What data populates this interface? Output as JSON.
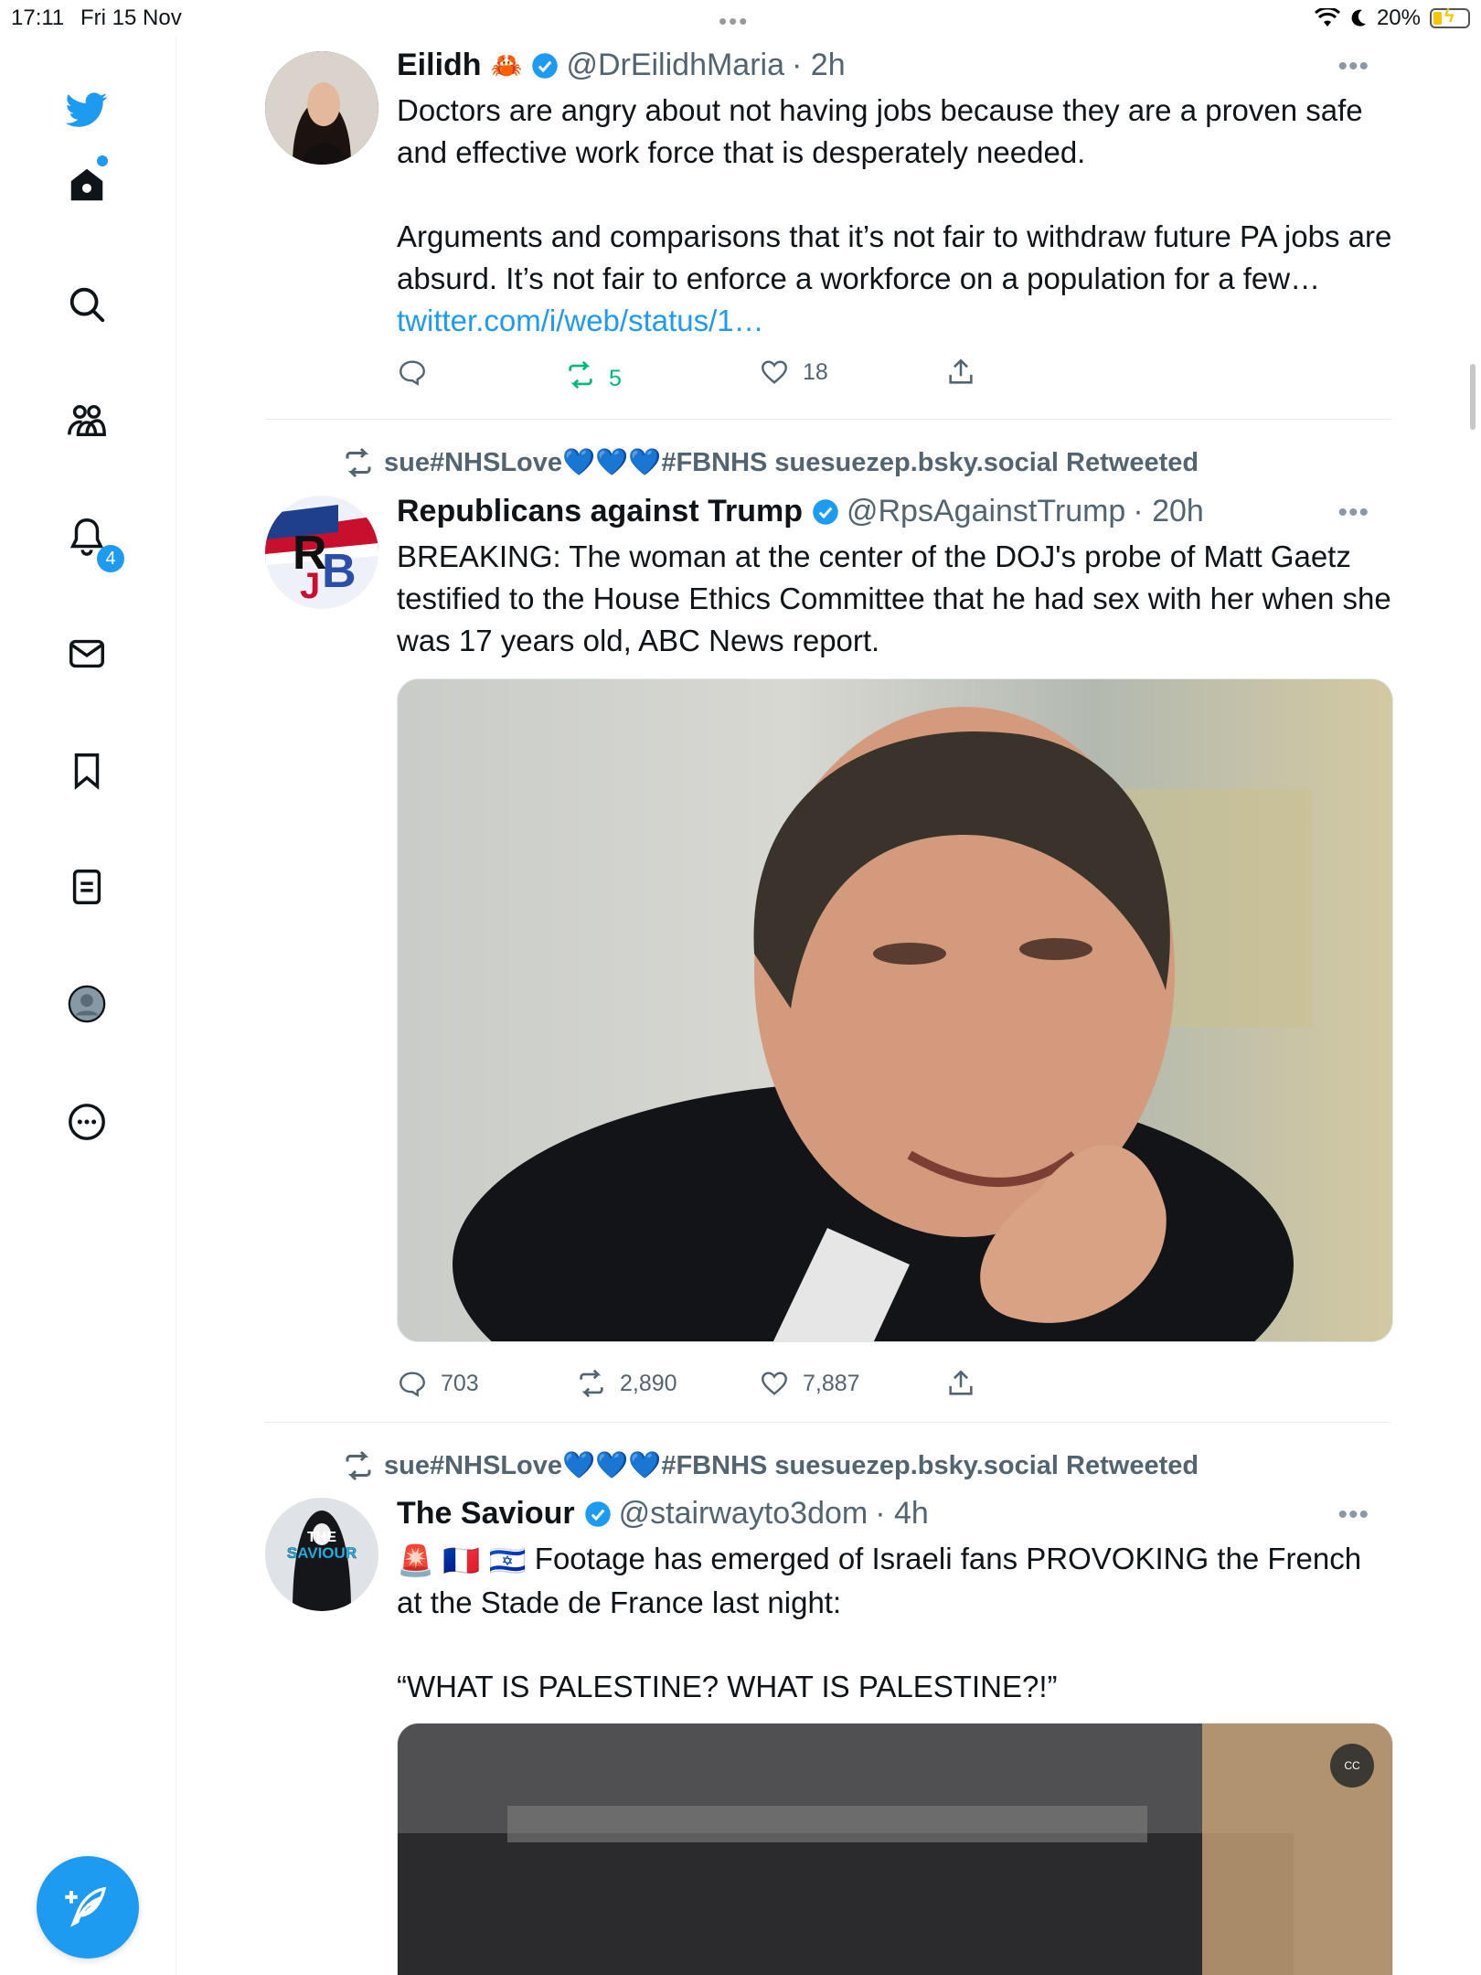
{
  "status_bar": {
    "time": "17:11",
    "date": "Fri 15 Nov",
    "battery": "20%"
  },
  "sidebar": {
    "notifications_badge": "4",
    "items": [
      "twitter-logo",
      "home-icon",
      "search-icon",
      "communities-icon",
      "notifications-icon",
      "messages-icon",
      "bookmarks-icon",
      "lists-icon",
      "profile-icon",
      "more-icon"
    ]
  },
  "colors": {
    "accent": "#1d9bf0",
    "retweet_active": "#00ba7c",
    "muted": "#536471"
  },
  "tweets": [
    {
      "name": "Eilidh",
      "name_emoji": "🦀",
      "handle": "@DrEilidhMaria",
      "time": "· 2h",
      "text_1": "Doctors are angry about not having jobs because they are a proven safe and effective work force that is desperately needed.",
      "text_2": "Arguments and comparisons that it’s not fair to withdraw future PA jobs are absurd. It’s not fair to enforce a workforce on a population for a few…",
      "link": "twitter.com/i/web/status/1…",
      "replies": "",
      "retweets": "5",
      "likes": "18"
    },
    {
      "retweeted_by": "sue#NHSLove💙💙💙#FBNHS suesuezep.bsky.social Retweeted",
      "name": "Republicans against Trump",
      "handle": "@RpsAgainstTrump",
      "time": "· 20h",
      "text": "BREAKING: The woman at the center of the DOJ's probe of Matt Gaetz testified to the House Ethics Committee that he had sex with her when she was 17 years old, ABC News report.",
      "avatar_text": "RJB",
      "replies": "703",
      "retweets": "2,890",
      "likes": "7,887"
    },
    {
      "retweeted_by": "sue#NHSLove💙💙💙#FBNHS suesuezep.bsky.social Retweeted",
      "name": "The Saviour",
      "handle": "@stairwayto3dom",
      "time": "· 4h",
      "text_1": "Footage has emerged of Israeli fans PROVOKING the French at the Stade de France last night:",
      "text_emoji": "🚨 🇫🇷 🇮🇱",
      "text_2": "“WHAT IS PALESTINE? WHAT IS PALESTINE?!”",
      "avatar_text": "THE SAVIOUR",
      "cc_label": "CC"
    }
  ],
  "more_label": "•••"
}
